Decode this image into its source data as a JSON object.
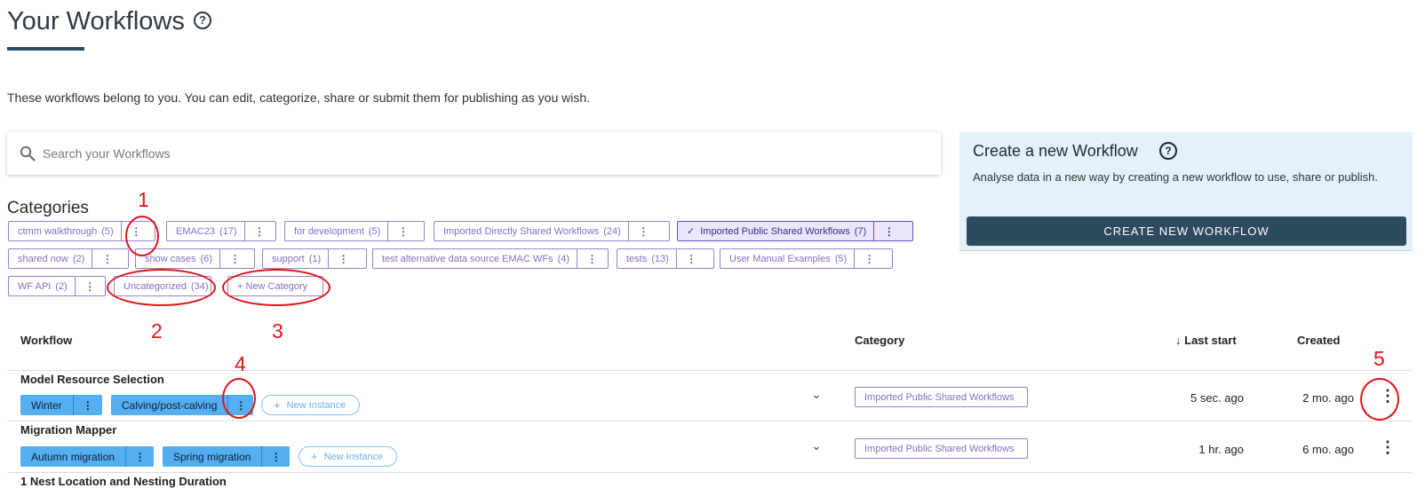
{
  "page": {
    "title": "Your Workflows",
    "help_glyph": "?",
    "intro": "These workflows belong to you. You can edit, categorize, share or submit them for publishing as you wish."
  },
  "search": {
    "placeholder": "Search your Workflows",
    "value": ""
  },
  "create_panel": {
    "title": "Create a new Workflow",
    "help_glyph": "?",
    "description": "Analyse data in a new way by creating a new workflow to use, share or publish.",
    "button_label": "CREATE NEW WORKFLOW"
  },
  "categories": {
    "heading": "Categories",
    "items": [
      {
        "label": "ctmm walkthrough",
        "count": "(5)"
      },
      {
        "label": "EMAC23",
        "count": "(17)"
      },
      {
        "label": "for development",
        "count": "(5)"
      },
      {
        "label": "Imported Directly Shared Workflows",
        "count": "(24)"
      },
      {
        "label": "Imported Public Shared Workflows",
        "count": "(7)",
        "selected": true
      },
      {
        "label": "shared now",
        "count": "(2)"
      },
      {
        "label": "show cases",
        "count": "(6)"
      },
      {
        "label": "support",
        "count": "(1)"
      },
      {
        "label": "test alternative data source EMAC WFs",
        "count": "(4)"
      },
      {
        "label": "tests",
        "count": "(13)"
      },
      {
        "label": "User Manual Examples",
        "count": "(5)"
      },
      {
        "label": "WF API",
        "count": "(2)"
      },
      {
        "label": "Uncategorized",
        "count": "(34)"
      }
    ],
    "new_category_label": "+ New Category",
    "more_glyph": "⋮",
    "check_glyph": "✓"
  },
  "table": {
    "headers": {
      "workflow": "Workflow",
      "category": "Category",
      "last_start": "Last start",
      "created": "Created",
      "sort_glyph": "↓"
    },
    "rows": [
      {
        "name": "Model Resource Selection",
        "tags": [
          "Winter",
          "Calving/post-calving"
        ],
        "new_instance": "New Instance",
        "category": "Imported Public Shared Workflows",
        "last_start": "5 sec. ago",
        "created": "2 mo. ago"
      },
      {
        "name": "Migration Mapper",
        "tags": [
          "Autumn migration",
          "Spring migration"
        ],
        "new_instance": "New Instance",
        "category": "Imported Public Shared Workflows",
        "last_start": "1 hr. ago",
        "created": "6 mo. ago"
      },
      {
        "name": "1 Nest Location and Nesting Duration"
      }
    ],
    "expand_glyph": "⌄",
    "menu_glyph": "⋮",
    "plus_glyph": "+"
  },
  "annotations": [
    "1",
    "2",
    "3",
    "4",
    "5"
  ],
  "colors": {
    "title": "#2d3b46",
    "accent_underline": "#2d4a63",
    "category_chip": "#9c7fd0",
    "selected_chip_bg": "#ece6fb",
    "tag_bg": "#55aef0",
    "create_button": "#2e4a5e",
    "create_panel_bg": "#e3f1fb",
    "annotation": "#e0141b"
  }
}
